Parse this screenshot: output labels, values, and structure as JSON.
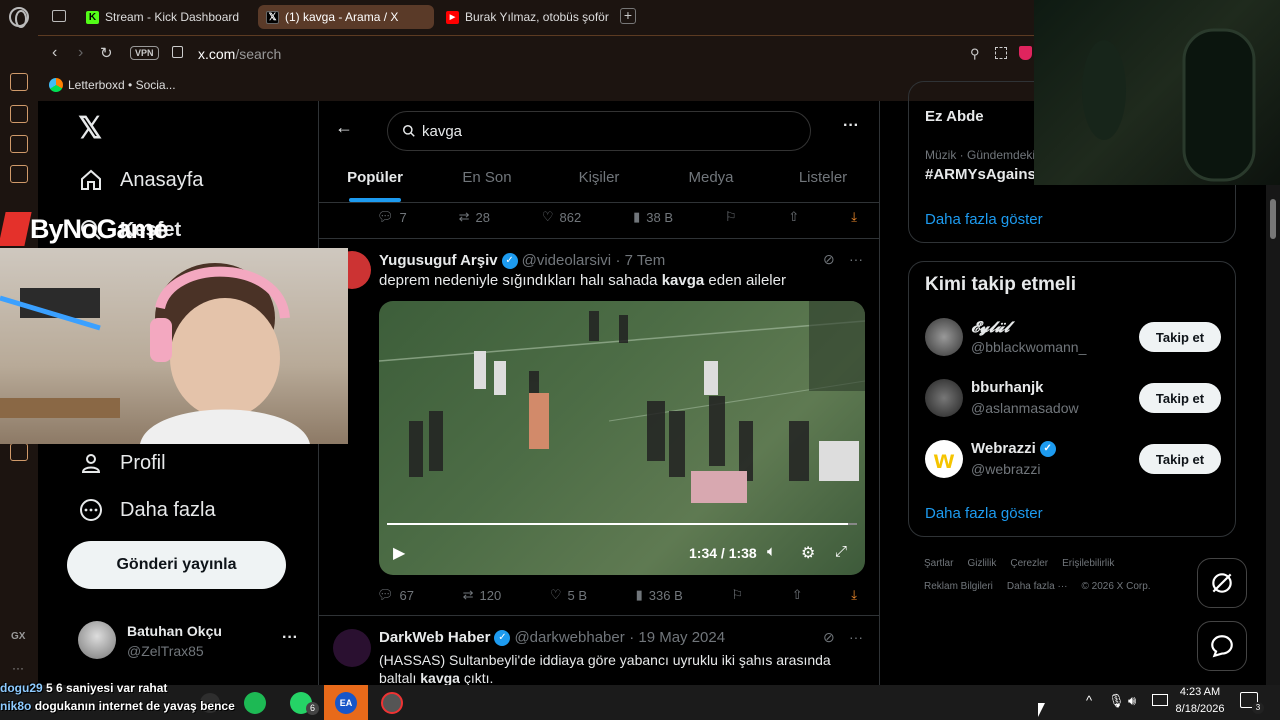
{
  "browser": {
    "tabs": [
      {
        "label": "Stream - Kick Dashboard",
        "icon": "kick-icon"
      },
      {
        "label": "(1) kavga - Arama / X",
        "icon": "x-icon"
      },
      {
        "label": "Burak Yılmaz, otobüs şoför",
        "icon": "youtube-icon"
      }
    ],
    "vpn": "VPN",
    "url_domain": "x.com",
    "url_path": "/search",
    "bookmark": "Letterboxd • Socia..."
  },
  "overlay": {
    "brand": "ByNoGame"
  },
  "x_nav": {
    "home": "Anasayfa",
    "explore": "Keşfet",
    "profile": "Profil",
    "more": "Daha fazla",
    "post_button": "Gönderi yayınla",
    "account_name": "Batuhan Okçu",
    "account_handle": "@ZelTrax85"
  },
  "search": {
    "query": "kavga",
    "tabs": [
      "Popüler",
      "En Son",
      "Kişiler",
      "Medya",
      "Listeler"
    ]
  },
  "top_actions": {
    "replies": "7",
    "reposts": "28",
    "likes": "862",
    "views": "38 B"
  },
  "tweet1": {
    "name": "Yugusuguf Arşiv",
    "handle": "@videolarsivi",
    "time": "· 7 Tem",
    "text_before": "deprem nedeniyle sığındıkları halı sahada ",
    "text_bold": "kavga",
    "text_after": " eden aileler",
    "video_time": "1:34 / 1:38",
    "video_progress": 0.98,
    "replies": "67",
    "reposts": "120",
    "likes": "5 B",
    "views": "336 B"
  },
  "tweet2": {
    "name": "DarkWeb Haber",
    "handle": "@darkwebhaber",
    "time": "· 19 May 2024",
    "text_line1": "(HASSAS) Sultanbeyli'de iddiaya göre yabancı uyruklu iki şahıs arasında",
    "text_line2_before": "baltalı ",
    "text_line2_bold": "kavga",
    "text_line2_after": " çıktı."
  },
  "trends": {
    "top_name": "Ez Abde",
    "category": "Müzik · Gündemdeki",
    "tag": "#ARMYsAgainst",
    "show_more": "Daha fazla göster"
  },
  "who_to_follow": {
    "title": "Kimi takip etmeli",
    "users": [
      {
        "name": "𝓔𝔂𝓵𝓾̈𝓵",
        "handle": "@bblackwomann_",
        "button": "Takip et"
      },
      {
        "name": "bburhanjk",
        "handle": "@aslanmasadow",
        "button": "Takip et"
      },
      {
        "name": "Webrazzi",
        "handle": "@webrazzi",
        "button": "Takip et",
        "verified": true
      }
    ],
    "show_more": "Daha fazla göster"
  },
  "footer": {
    "line1": [
      "Şartlar",
      "Gizlilik",
      "Çerezler",
      "Erişilebilirlik"
    ],
    "line2": [
      "Reklam Bilgileri",
      "Daha fazla ···",
      "© 2026 X Corp."
    ]
  },
  "chat": [
    {
      "user": "dogu29",
      "msg": "5 6 saniyesi var rahat"
    },
    {
      "user": "nik8o",
      "msg": "dogukanın internet de yavaş bence"
    }
  ],
  "taskbar": {
    "time": "4:23 AM",
    "date": "8/18/2026",
    "whatsapp_badge": "6",
    "notif_badge": "3"
  },
  "sidebar_gx": "GX"
}
